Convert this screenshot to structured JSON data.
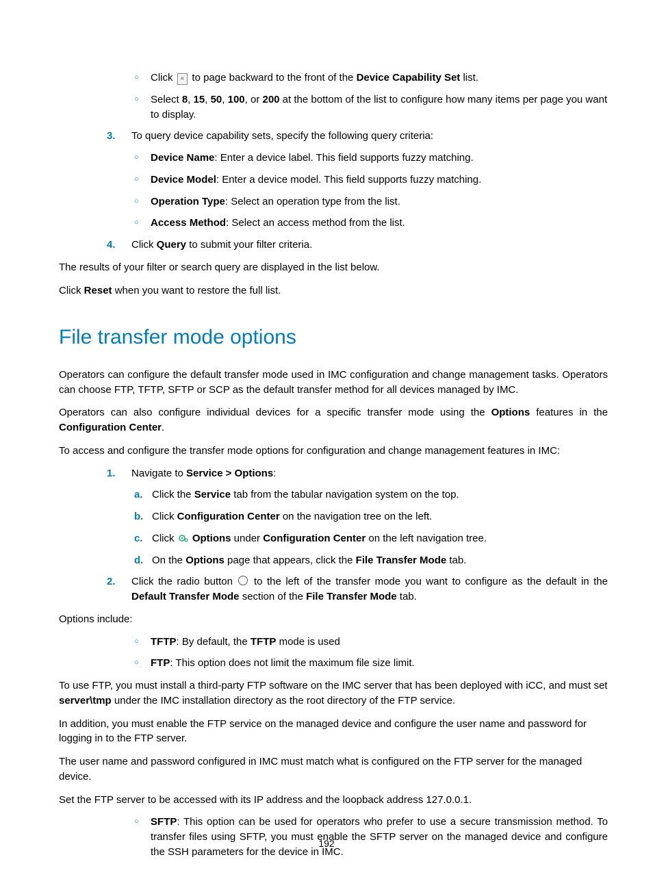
{
  "page_number": "192",
  "section1_items": {
    "bullet1_pre": "Click ",
    "bullet1_post": " to page backward to the front of the ",
    "bullet1_bold": "Device Capability Set",
    "bullet1_end": " list.",
    "bullet2_pre": "Select ",
    "bullet2_b1": "8",
    "bullet2_s1": ", ",
    "bullet2_b2": "15",
    "bullet2_s2": ", ",
    "bullet2_b3": "50",
    "bullet2_s3": ", ",
    "bullet2_b4": "100",
    "bullet2_s4": ", or ",
    "bullet2_b5": "200",
    "bullet2_end": " at the bottom of the list to configure how many items per page you want to display."
  },
  "step3": {
    "num": "3.",
    "text": "To query device capability sets, specify the following query criteria:",
    "items": [
      {
        "bold": "Device Name",
        "rest": ": Enter a device label. This field supports fuzzy matching."
      },
      {
        "bold": "Device Model",
        "rest": ": Enter a device model. This field supports fuzzy matching."
      },
      {
        "bold": "Operation Type",
        "rest": ": Select an operation type from the list."
      },
      {
        "bold": "Access Method",
        "rest": ": Select an access method from the list."
      }
    ]
  },
  "step4": {
    "num": "4.",
    "line1_pre": "Click ",
    "line1_bold": "Query",
    "line1_post": " to submit your filter criteria.",
    "line2": "The results of your filter or search query are displayed in the list below.",
    "line3_pre": "Click ",
    "line3_bold": "Reset",
    "line3_post": " when you want to restore the full list."
  },
  "heading": "File transfer mode options",
  "intro_p1": "Operators can configure the default transfer mode used in IMC configuration and change management tasks. Operators can choose FTP, TFTP, SFTP or SCP as the default transfer method for all devices managed by IMC.",
  "intro_p2_pre": "Operators can also configure individual devices for a specific transfer mode using the ",
  "intro_p2_b1": "Options",
  "intro_p2_mid": " features in the ",
  "intro_p2_b2": "Configuration Center",
  "intro_p2_end": ".",
  "intro_p3": "To access and configure the transfer mode options for configuration and change management features in IMC:",
  "ft_step1": {
    "num": "1.",
    "line_pre": "Navigate to ",
    "line_bold": "Service > Options",
    "line_post": ":",
    "a": {
      "m": "a.",
      "pre": "Click the ",
      "b": "Service",
      "post": " tab from the tabular navigation system on the top."
    },
    "b": {
      "m": "b.",
      "pre": "Click ",
      "b": "Configuration Center",
      "post": " on the navigation tree on the left."
    },
    "c": {
      "m": "c.",
      "pre": "Click ",
      "b1": "Options",
      "mid": " under ",
      "b2": "Configuration Center",
      "post": " on the left navigation tree."
    },
    "d": {
      "m": "d.",
      "pre": "On the ",
      "b1": "Options",
      "mid": " page that appears, click the ",
      "b2": "File Transfer Mode",
      "post": " tab."
    }
  },
  "ft_step2": {
    "num": "2.",
    "pre": "Click the radio button ",
    "mid": " to the left of the transfer mode you want to configure as the default in the ",
    "b1": "Default Transfer Mode",
    "mid2": " section of the ",
    "b2": "File Transfer Mode",
    "post": " tab.",
    "opts_label": "Options include:",
    "tftp": {
      "b": "TFTP",
      "pre": ": By default, the ",
      "b2": "TFTP",
      "post": " mode is used"
    },
    "ftp": {
      "b": "FTP",
      "line1": ": This option does not limit the maximum file size limit.",
      "p2_pre": "To use FTP, you must install a third-party FTP software on the IMC server that has been deployed with iCC, and must set ",
      "p2_b": "server\\tmp",
      "p2_post": " under the IMC installation directory as the root directory of the FTP service.",
      "p3": "In addition, you must enable the FTP service on the managed device and configure the user name and password for logging in to the FTP server.",
      "p4": "The user name and password configured in IMC must match what is configured on the FTP server for the managed device.",
      "p5": "Set the FTP server to be accessed with its IP address and the loopback address 127.0.0.1."
    },
    "sftp": {
      "b": "SFTP",
      "rest": ": This option can be used for operators who prefer to use a secure transmission method. To transfer files using SFTP, you must enable the SFTP server on the managed device and configure the SSH parameters for the device in IMC."
    }
  }
}
